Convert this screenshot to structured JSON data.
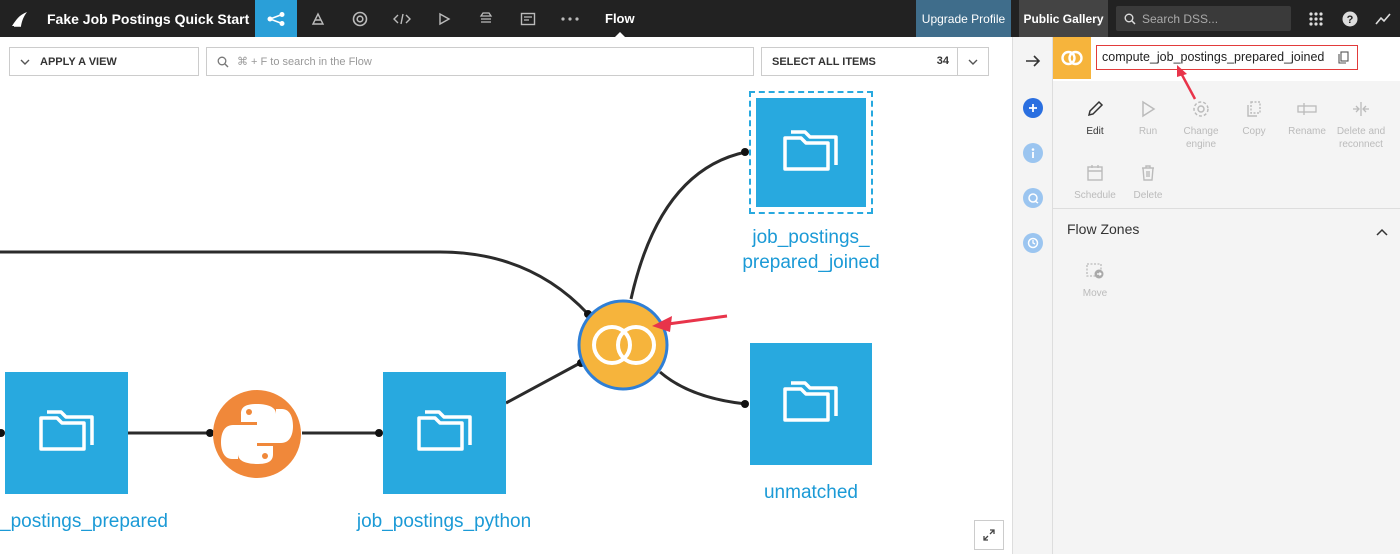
{
  "topbar": {
    "project_title": "Fake Job Postings Quick Start",
    "active_section": "Flow",
    "upgrade_label": "Upgrade Profile",
    "gallery_label": "Public Gallery",
    "search_placeholder": "Search DSS..."
  },
  "flow_toolbar": {
    "apply_view_label": "APPLY A VIEW",
    "search_placeholder": "⌘ + F to search in the Flow",
    "select_all_label": "SELECT ALL ITEMS",
    "item_count": "34"
  },
  "nodes": {
    "left_dataset_label": "_postings_prepared",
    "python_dataset_label": "job_postings_python",
    "joined_dataset_label_line1": "job_postings_",
    "joined_dataset_label_line2": "prepared_joined",
    "unmatched_label": "unmatched"
  },
  "panel": {
    "recipe_name": "compute_job_postings_prepared_joined",
    "actions": {
      "edit": "Edit",
      "run": "Run",
      "change_engine_1": "Change",
      "change_engine_2": "engine",
      "copy": "Copy",
      "rename": "Rename",
      "delete_reconnect_1": "Delete and",
      "delete_reconnect_2": "reconnect",
      "schedule": "Schedule",
      "delete": "Delete"
    },
    "zones_title": "Flow Zones",
    "move_label": "Move"
  },
  "colors": {
    "topbar": "#222222",
    "active_nav": "#2a9fd8",
    "dataset": "#28a9df",
    "join_recipe": "#f6b43c",
    "python_recipe": "#f0883a",
    "highlight": "#e23b3b"
  }
}
